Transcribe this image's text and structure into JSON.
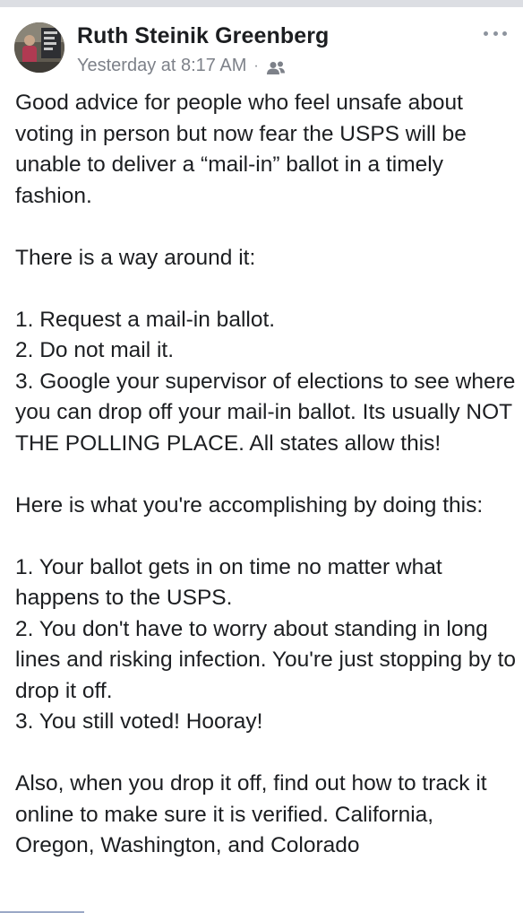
{
  "post": {
    "author": "Ruth Steinik Greenberg",
    "timestamp": "Yesterday at 8:17 AM",
    "separator": "·",
    "audience_icon": "friends-icon",
    "more_icon": "more-options-icon",
    "body": {
      "intro": "Good advice for people who feel unsafe about voting in person but now fear the USPS will be unable to deliver a “mail-in” ballot in a timely fashion.",
      "way_around": "There is a way around it:",
      "steps": [
        "1. Request a mail-in ballot.",
        "2. Do not mail it.",
        "3. Google your supervisor of elections to see where you can drop off your mail-in ballot. Its usually NOT THE POLLING PLACE. All states allow this!"
      ],
      "accomplishing": "Here is what you're accomplishing by doing this:",
      "benefits": [
        "1. Your ballot gets in on time no matter what happens to the USPS.",
        "2. You don't have to worry about standing in long lines and risking infection. You're just stopping by to drop it off.",
        "3. You still voted! Hooray!"
      ],
      "closing": "Also, when you drop it off, find out how to track it online to make sure it is verified. California, Oregon, Washington, and Colorado"
    }
  },
  "colors": {
    "text": "#1c1e21",
    "meta": "#7d8189",
    "icon_gray": "#8d949e",
    "top_bar": "#dcdee3"
  }
}
